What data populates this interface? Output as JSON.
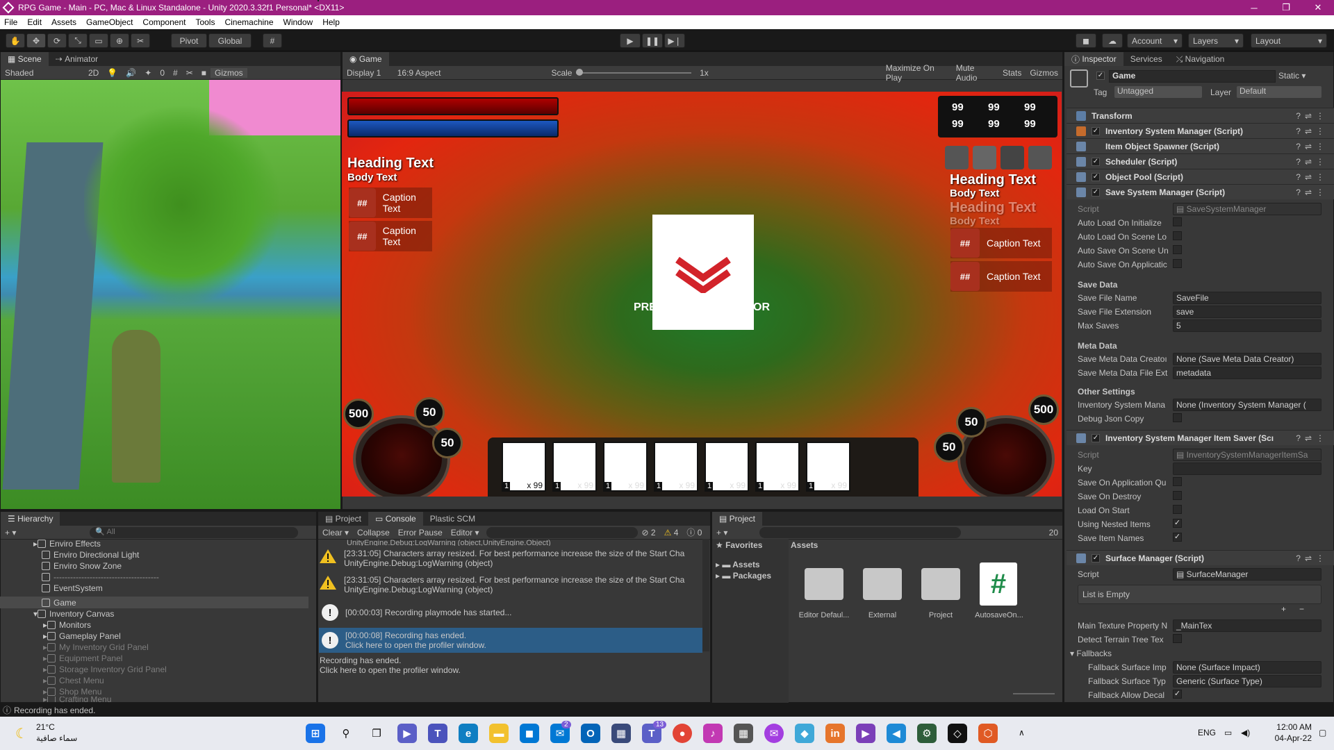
{
  "window": {
    "title": "RPG Game - Main - PC, Mac & Linux Standalone - Unity 2020.3.32f1 Personal* <DX11>",
    "min": "─",
    "max": "❐",
    "close": "✕"
  },
  "menu": [
    "File",
    "Edit",
    "Assets",
    "GameObject",
    "Component",
    "Tools",
    "Cinemachine",
    "Window",
    "Help"
  ],
  "toolbar": {
    "pivot": "Pivot",
    "global": "Global",
    "account": "Account",
    "layers": "Layers",
    "layout": "Layout"
  },
  "scene": {
    "tabs": [
      "Scene",
      "Animator"
    ],
    "shading": "Shaded",
    "mode2d": "2D",
    "hidden_count": "0",
    "gizmos": "Gizmos"
  },
  "game": {
    "tab": "Game",
    "display": "Display 1",
    "aspect": "16:9 Aspect",
    "scale_label": "Scale",
    "scale_value": "1x",
    "toggles": [
      "Maximize On Play",
      "Mute Audio",
      "Stats",
      "Gizmos"
    ],
    "stat_values": [
      "99",
      "99",
      "99",
      "99",
      "99",
      "99"
    ],
    "left_panel": {
      "heading": "Heading Text",
      "body": "Body Text",
      "captions": [
        "Caption Text",
        "Caption Text"
      ]
    },
    "right_panel": {
      "heading": "Heading Text",
      "body": "Body Text",
      "heading2": "Heading Text",
      "body2": "Body Text",
      "captions": [
        "Caption Text",
        "Caption Text"
      ]
    },
    "icon_text": "##",
    "prompt_left": "PRE",
    "prompt_right": "OR",
    "coins_left": [
      "500",
      "50",
      "50"
    ],
    "coins_right": [
      "500",
      "50",
      "50"
    ],
    "slot_number": "1",
    "slot_qty": "x 99",
    "colors": {
      "health": "#7a0000",
      "mana": "#0a3a8a",
      "chevron": "#d2232a"
    }
  },
  "inspector": {
    "tabs": [
      "Inspector",
      "Services",
      "Navigation"
    ],
    "object_name": "Game",
    "static_label": "Static",
    "tag_label": "Tag",
    "tag_value": "Untagged",
    "layer_label": "Layer",
    "layer_value": "Default",
    "components": [
      "Transform",
      "Inventory System Manager (Script)",
      "Item Object Spawner (Script)",
      "Scheduler (Script)",
      "Object Pool (Script)",
      "Save System Manager (Script)"
    ],
    "save_system": {
      "script_label": "Script",
      "script_value": "SaveSystemManager",
      "auto_props": [
        "Auto Load On Initialize",
        "Auto Load On Scene Lo",
        "Auto Save On Scene Un",
        "Auto Save On Applicatic"
      ],
      "save_data_header": "Save Data",
      "file_name_label": "Save File Name",
      "file_name_value": "SaveFile",
      "file_ext_label": "Save File Extension",
      "file_ext_value": "save",
      "max_saves_label": "Max Saves",
      "max_saves_value": "5",
      "meta_header": "Meta Data",
      "meta_creator_label": "Save Meta Data Creatoı",
      "meta_creator_value": "None (Save Meta Data Creator)",
      "meta_ext_label": "Save Meta Data File Ext",
      "meta_ext_value": "metadata",
      "other_header": "Other Settings",
      "inv_mgr_label": "Inventory System Mana",
      "inv_mgr_value": "None (Inventory System Manager (",
      "debug_label": "Debug Json Copy"
    },
    "item_saver": {
      "title": "Inventory System Manager Item Saver (Scı",
      "script_label": "Script",
      "script_value": "InventorySystemManagerItemSa",
      "key_label": "Key",
      "props": [
        "Save On Application Qu",
        "Save On Destroy",
        "Load On Start",
        "Using Nested Items",
        "Save Item Names"
      ],
      "checked": [
        false,
        false,
        false,
        true,
        true
      ]
    },
    "surface": {
      "title": "Surface Manager (Script)",
      "script_label": "Script",
      "script_value": "SurfaceManager",
      "list_empty": "List is Empty",
      "main_tex_label": "Main Texture Property N",
      "main_tex_value": "_MainTex",
      "detect_label": "Detect Terrain Tree Tex",
      "fallbacks": "Fallbacks",
      "fb_impact_label": "Fallback Surface Imp",
      "fb_impact_value": "None (Surface Impact)",
      "fb_type_label": "Fallback Surface Typ",
      "fb_type_value": "Generic (Surface Type)",
      "fb_decal_label": "Fallback Allow Decal"
    }
  },
  "hierarchy": {
    "tab": "Hierarchy",
    "search_placeholder": "All",
    "items": [
      {
        "label": "Enviro Effects",
        "indent": 1,
        "dim": false
      },
      {
        "label": "Enviro Directional Light",
        "indent": 1,
        "dim": false
      },
      {
        "label": "Enviro Snow Zone",
        "indent": 1,
        "dim": false
      },
      {
        "label": "--------------------------------------",
        "indent": 1,
        "dim": false
      },
      {
        "label": "EventSystem",
        "indent": 1,
        "dim": false
      },
      {
        "label": "Game",
        "indent": 1,
        "dim": false
      },
      {
        "label": "Inventory Canvas",
        "indent": 1,
        "dim": false
      },
      {
        "label": "Monitors",
        "indent": 2,
        "dim": false
      },
      {
        "label": "Gameplay Panel",
        "indent": 2,
        "dim": false
      },
      {
        "label": "My Inventory Grid Panel",
        "indent": 2,
        "dim": true
      },
      {
        "label": "Equipment Panel",
        "indent": 2,
        "dim": true
      },
      {
        "label": "Storage Inventory Grid Panel",
        "indent": 2,
        "dim": true
      },
      {
        "label": "Chest Menu",
        "indent": 2,
        "dim": true
      },
      {
        "label": "Shop Menu",
        "indent": 2,
        "dim": true
      },
      {
        "label": "Crafting Menu",
        "indent": 2,
        "dim": true
      }
    ]
  },
  "console": {
    "tabs": [
      "Project",
      "Console",
      "Plastic SCM"
    ],
    "buttons": [
      "Clear",
      "Collapse",
      "Error Pause",
      "Editor"
    ],
    "counts": {
      "errors": "2",
      "warnings": "4",
      "infos": "0"
    },
    "top_cut": "UnityEngine.Debug:LogWarning (object,UnityEngine.Object)",
    "entries": [
      {
        "type": "warn",
        "line1": "[23:31:05] Characters array resized. For best performance increase the size of the Start Cha",
        "line2": "UnityEngine.Debug:LogWarning (object)"
      },
      {
        "type": "warn",
        "line1": "[23:31:05] Characters array resized. For best performance increase the size of the Start Cha",
        "line2": "UnityEngine.Debug:LogWarning (object)"
      },
      {
        "type": "info",
        "line1": "[00:00:03] Recording playmode has started...",
        "line2": ""
      },
      {
        "type": "info",
        "line1": "[00:00:08] Recording has ended.",
        "line2": "Click here to open the profiler window."
      }
    ],
    "detail1": "Recording has ended.",
    "detail2": "Click here to open the profiler window."
  },
  "project": {
    "tab": "Project",
    "favorites": "Favorites",
    "assets": "Assets",
    "packages": "Packages",
    "assets_header": "Assets",
    "hidden_count": "20",
    "items": [
      "Editor Defaul...",
      "External",
      "Project",
      "AutosaveOn..."
    ]
  },
  "statusbar": {
    "message": "Recording has ended."
  },
  "taskbar": {
    "weather_temp": "21°C",
    "weather_text": "سماء صافية",
    "lang": "ENG",
    "time": "12:00 AM",
    "date": "04-Apr-22",
    "badge_mail": "2",
    "badge_teams": "13"
  }
}
